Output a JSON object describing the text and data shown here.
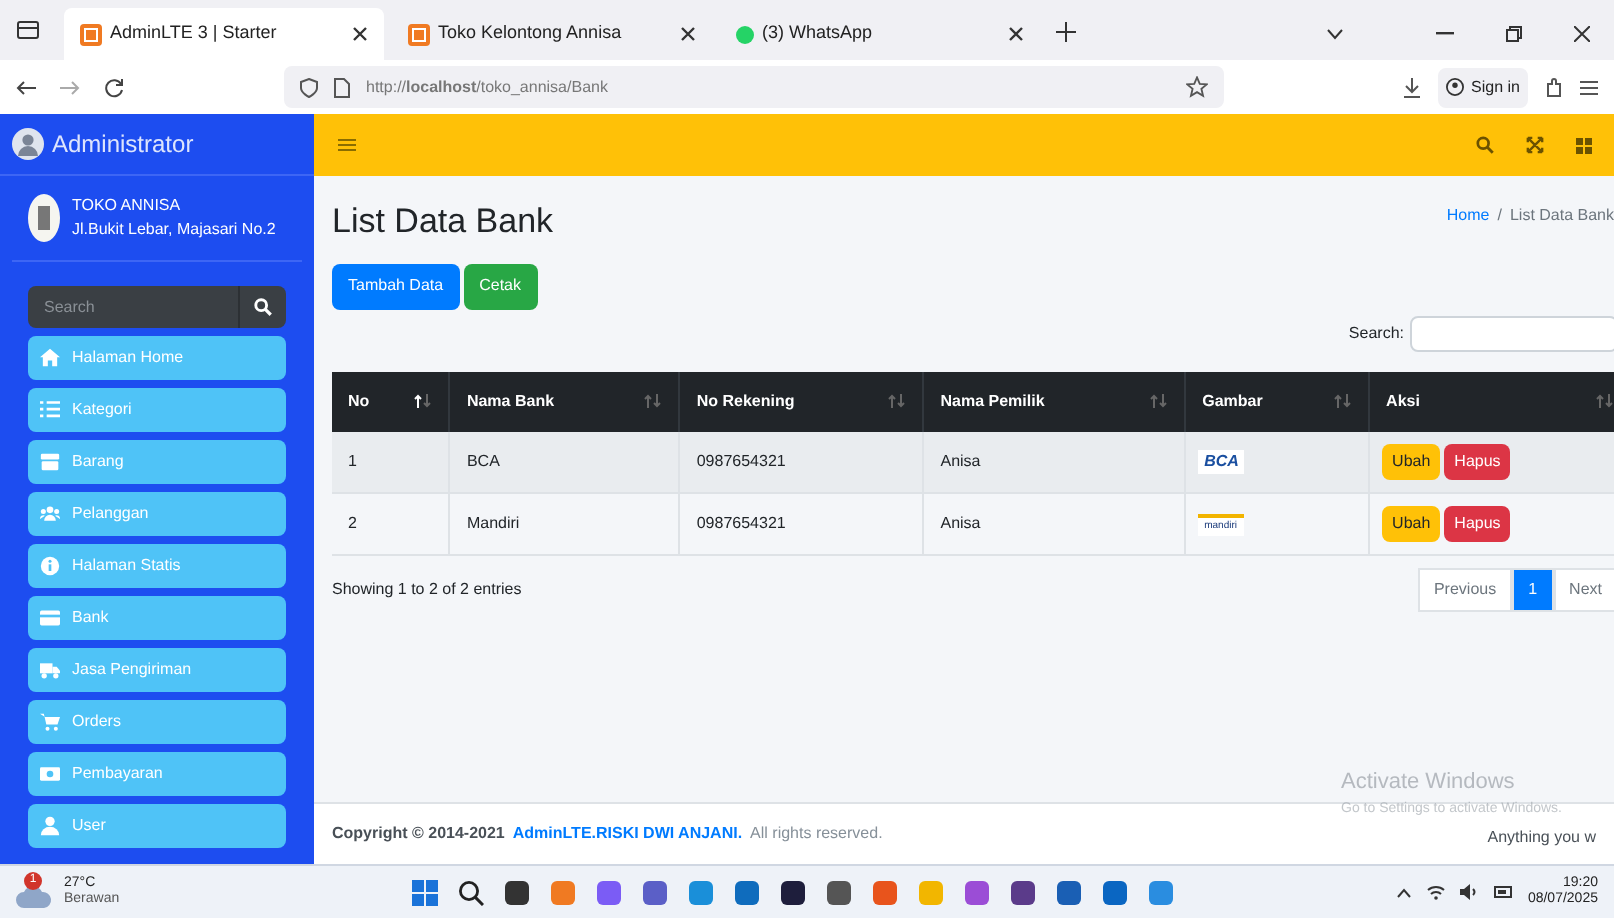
{
  "browser": {
    "tabs": [
      {
        "title": "AdminLTE 3 | Starter",
        "selected": true,
        "kind": "admin"
      },
      {
        "title": "Toko Kelontong Annisa",
        "selected": false,
        "kind": "admin"
      },
      {
        "title": "(3) WhatsApp",
        "selected": false,
        "kind": "whatsapp"
      }
    ],
    "url": "http://**localhost**/toko_annisa/Bank",
    "sign_in": "Sign in"
  },
  "sidebar": {
    "brand": "Administrator",
    "store_name": "TOKO ANNISA",
    "store_address": "Jl.Bukit Lebar, Majasari No.2",
    "search": {
      "placeholder": "Search"
    },
    "menu": [
      {
        "label": "Halaman Home",
        "kind": "home"
      },
      {
        "label": "Kategori",
        "kind": "list"
      },
      {
        "label": "Barang",
        "kind": "box"
      },
      {
        "label": "Pelanggan",
        "kind": "users"
      },
      {
        "label": "Halaman Statis",
        "kind": "info"
      },
      {
        "label": "Bank",
        "kind": "card"
      },
      {
        "label": "Jasa Pengiriman",
        "kind": "truck"
      },
      {
        "label": "Orders",
        "kind": "cart"
      },
      {
        "label": "Pembayaran",
        "kind": "money"
      },
      {
        "label": "User",
        "kind": "user"
      }
    ]
  },
  "content": {
    "title": "List Data Bank",
    "breadcrumb_separator": "/",
    "breadcrumb": [
      {
        "label": "Home",
        "link": true
      },
      {
        "label": "List Data Bank",
        "link": false
      }
    ],
    "buttons": [
      {
        "label": "Tambah Data",
        "kind": "primary"
      },
      {
        "label": "Cetak",
        "kind": "success"
      }
    ],
    "search_label": "Search:",
    "table": {
      "columns": [
        {
          "label": "No",
          "sorted": true
        },
        {
          "label": "Nama Bank",
          "sorted": false
        },
        {
          "label": "No Rekening",
          "sorted": false
        },
        {
          "label": "Nama Pemilik",
          "sorted": false
        },
        {
          "label": "Gambar",
          "sorted": false
        },
        {
          "label": "Aksi",
          "sorted": false
        }
      ],
      "rows": [
        {
          "no": "1",
          "bank": "BCA",
          "account": "0987654321",
          "owner": "Anisa",
          "logo": {
            "kind": "bca",
            "text": "BCA"
          },
          "actions": [
            "Ubah",
            "Hapus"
          ]
        },
        {
          "no": "2",
          "bank": "Mandiri",
          "account": "0987654321",
          "owner": "Anisa",
          "logo": {
            "kind": "mandiri",
            "text": "mandiri"
          },
          "actions": [
            "Ubah",
            "Hapus"
          ]
        }
      ]
    },
    "info": "Showing 1 to 2 of 2 entries",
    "pagination": [
      {
        "label": "Previous",
        "selected": false
      },
      {
        "label": "1",
        "selected": true
      },
      {
        "label": "Next",
        "selected": false
      }
    ]
  },
  "footer": {
    "prefix": "Copyright © 2014-2021",
    "link": "AdminLTE.RISKI DWI ANJANI.",
    "suffix": "All rights reserved.",
    "right": "Anything you w"
  },
  "activation": {
    "title": "Activate Windows",
    "subtitle": "Go to Settings to activate Windows."
  },
  "taskbar": {
    "temperature": "27°C",
    "weather": "Berawan",
    "badge": "1",
    "time": "19:20",
    "date": "08/07/2025"
  }
}
